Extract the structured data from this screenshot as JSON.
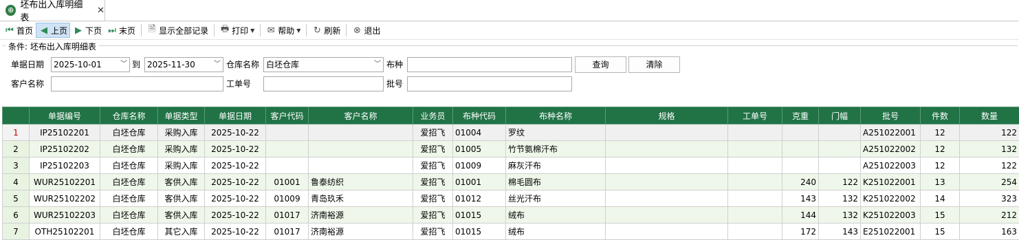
{
  "tab": {
    "icon": "globe-icon",
    "title": "坯布出入库明细表",
    "close": "✕"
  },
  "toolbar": [
    {
      "name": "first-page-button",
      "icon": "⏮",
      "label": "首页",
      "cls": "nav"
    },
    {
      "name": "prev-page-button",
      "icon": "◀",
      "label": "上页",
      "cls": "nav"
    },
    {
      "name": "next-page-button",
      "icon": "▶",
      "label": "下页",
      "cls": "nav"
    },
    {
      "name": "last-page-button",
      "icon": "⏭",
      "label": "末页",
      "cls": "nav"
    },
    {
      "name": "show-all-button",
      "icon": "🗎",
      "label": "显示全部记录",
      "cls": "gray"
    },
    {
      "name": "print-button",
      "icon": "🖶",
      "label": "打印",
      "cls": "gray",
      "dropdown": true
    },
    {
      "name": "help-button",
      "icon": "✉",
      "label": "帮助",
      "cls": "gray",
      "dropdown": true
    },
    {
      "name": "refresh-button",
      "icon": "↻",
      "label": "刷新",
      "cls": "gray"
    },
    {
      "name": "exit-button",
      "icon": "⊗",
      "label": "退出",
      "cls": "gray"
    }
  ],
  "conditions": {
    "title": "条件: 坯布出入库明细表",
    "date_label": "单据日期",
    "date_from": "2025-10-01",
    "to_label": "到",
    "date_to": "2025-11-30",
    "warehouse_label": "仓库名称",
    "warehouse": "白坯仓库",
    "fabric_label": "布种",
    "fabric": "",
    "query_button": "查询",
    "clear_button": "清除",
    "customer_label": "客户名称",
    "customer": "",
    "workorder_label": "工单号",
    "workorder": "",
    "batch_label": "批号",
    "batch": ""
  },
  "grid": {
    "columns": [
      "单据编号",
      "仓库名称",
      "单据类型",
      "单据日期",
      "客户代码",
      "客户名称",
      "业务员",
      "布种代码",
      "布种名称",
      "规格",
      "工单号",
      "克重",
      "门幅",
      "批号",
      "件数",
      "数量"
    ],
    "rows": [
      [
        "1",
        "IP25102201",
        "白坯仓库",
        "采购入库",
        "2025-10-22",
        "",
        "",
        "爱招飞",
        "01004",
        "罗纹",
        "",
        "",
        "",
        "",
        "A251022001",
        "12",
        "122"
      ],
      [
        "2",
        "IP25102202",
        "白坯仓库",
        "采购入库",
        "2025-10-22",
        "",
        "",
        "爱招飞",
        "01005",
        "竹节氨棉汗布",
        "",
        "",
        "",
        "",
        "A251022002",
        "12",
        "132"
      ],
      [
        "3",
        "IP25102203",
        "白坯仓库",
        "采购入库",
        "2025-10-22",
        "",
        "",
        "爱招飞",
        "01009",
        "麻灰汗布",
        "",
        "",
        "",
        "",
        "A251022003",
        "12",
        "122"
      ],
      [
        "4",
        "WUR25102201",
        "白坯仓库",
        "客供入库",
        "2025-10-22",
        "01001",
        "鲁泰纺织",
        "爱招飞",
        "01001",
        "棉毛圆布",
        "",
        "",
        "240",
        "122",
        "K251022001",
        "13",
        "254"
      ],
      [
        "5",
        "WUR25102202",
        "白坯仓库",
        "客供入库",
        "2025-10-22",
        "01009",
        "青岛玖禾",
        "爱招飞",
        "01012",
        "丝光汗布",
        "",
        "",
        "143",
        "132",
        "K251022002",
        "14",
        "323"
      ],
      [
        "6",
        "WUR25102203",
        "白坯仓库",
        "客供入库",
        "2025-10-22",
        "01017",
        "济南裕源",
        "爱招飞",
        "01015",
        "绒布",
        "",
        "",
        "144",
        "132",
        "K251022003",
        "15",
        "212"
      ],
      [
        "7",
        "OTH25102201",
        "白坯仓库",
        "其它入库",
        "2025-10-22",
        "01017",
        "济南裕源",
        "爱招飞",
        "01015",
        "绒布",
        "",
        "",
        "172",
        "143",
        "E251022001",
        "15",
        "163"
      ]
    ]
  }
}
